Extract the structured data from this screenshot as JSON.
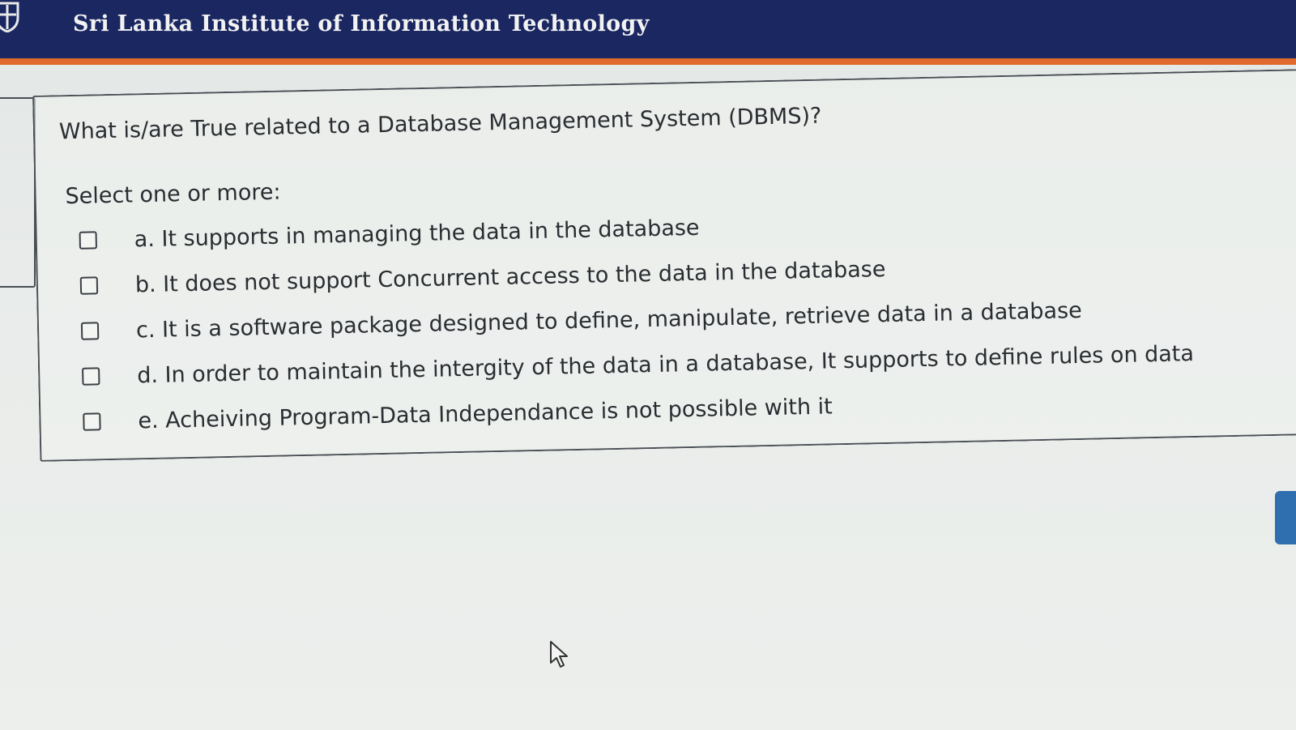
{
  "header": {
    "title": "Sri Lanka Institute of Information Technology",
    "brand_color": "#1a2761",
    "accent_color": "#e06a2e"
  },
  "question": {
    "text": "What is/are True related to a Database Management System (DBMS)?",
    "prompt": "Select one or more:",
    "options": [
      {
        "label": "a. It supports in managing the data in the database",
        "checked": false
      },
      {
        "label": "b. It does not support Concurrent access to the data in the database",
        "checked": false
      },
      {
        "label": "c. It is a software package designed to define, manipulate, retrieve data in a database",
        "checked": false
      },
      {
        "label": "d. In order to maintain the intergity of the data in a database, It supports to define rules on data",
        "checked": false
      },
      {
        "label": "e. Acheiving Program-Data Independance is not possible with it",
        "checked": false
      }
    ]
  },
  "icons": {
    "logo": "university-crest-icon",
    "cursor": "mouse-pointer-icon"
  }
}
